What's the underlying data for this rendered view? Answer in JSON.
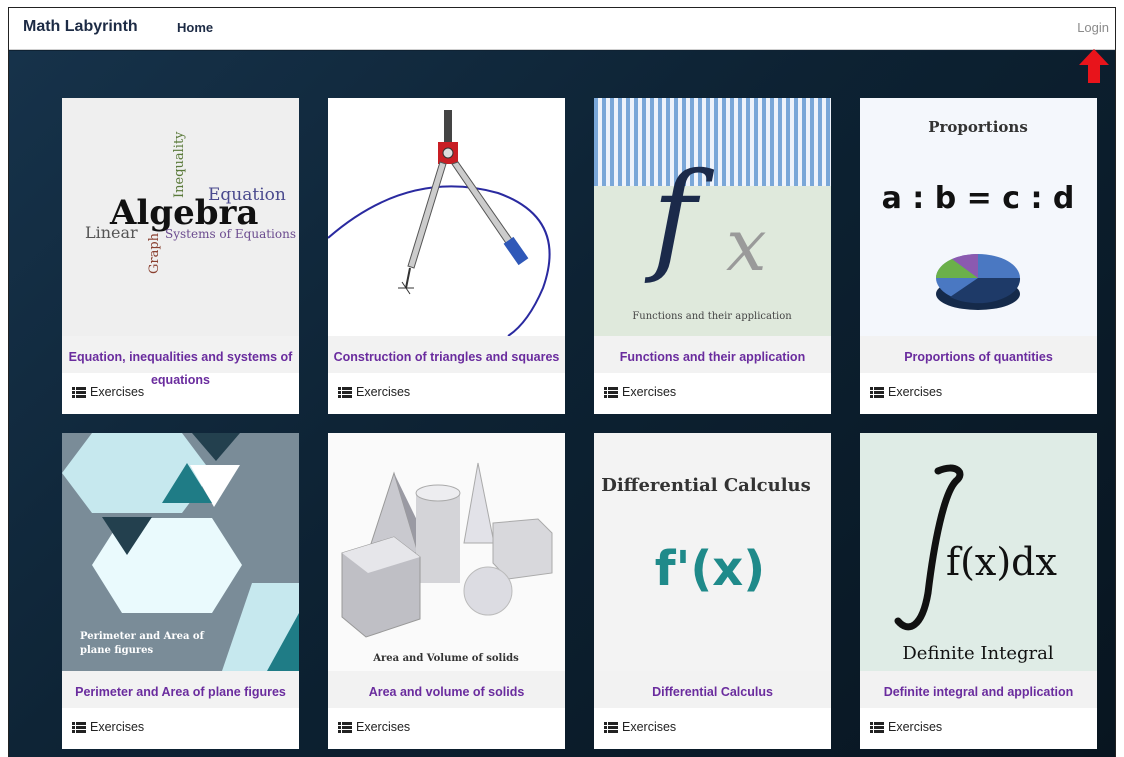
{
  "app": {
    "brand": "Math Labyrinth",
    "nav_home": "Home",
    "nav_login": "Login"
  },
  "colors": {
    "accent_title": "#6a2c9e",
    "arrow": "#e8141b",
    "background": "#0f2233"
  },
  "cards": [
    {
      "title": "Equation, inequalities and systems of equations",
      "action": "Exercises",
      "image_words": {
        "algebra": "Algebra",
        "equation": "Equation",
        "inequality": "Inequality",
        "linear": "Linear",
        "graph": "Graph",
        "systems": "Systems of Equations"
      }
    },
    {
      "title": "Construction of triangles and squares",
      "action": "Exercises"
    },
    {
      "title": "Functions and their application",
      "action": "Exercises",
      "image_caption": "Functions and their application"
    },
    {
      "title": "Proportions of quantities",
      "action": "Exercises",
      "image_heading": "Proportions",
      "image_formula": "a : b = c : d"
    },
    {
      "title": "Perimeter and Area of plane figures",
      "action": "Exercises",
      "image_caption_line1": "Perimeter and Area of",
      "image_caption_line2": "plane figures"
    },
    {
      "title": "Area and volume of solids",
      "action": "Exercises",
      "image_caption": "Area and Volume of solids"
    },
    {
      "title": "Differential Calculus",
      "action": "Exercises",
      "image_heading": "Differential Calculus",
      "image_formula": "f'(x)"
    },
    {
      "title": "Definite integral and application",
      "action": "Exercises",
      "image_formula": "f(x)dx",
      "image_caption": "Definite Integral"
    }
  ]
}
